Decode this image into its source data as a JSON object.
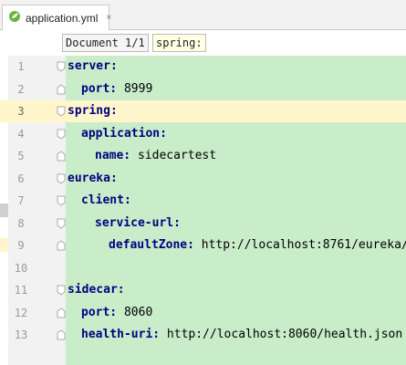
{
  "tab": {
    "file_name": "application.yml",
    "close_glyph": "×",
    "icon": "yaml-file-icon"
  },
  "breadcrumb": {
    "document": "Document 1/1",
    "path": "spring:"
  },
  "editor": {
    "caret_line": 3,
    "lines": [
      {
        "num": "1",
        "indent": 0,
        "key": "server:",
        "value": ""
      },
      {
        "num": "2",
        "indent": 1,
        "key": "port:",
        "value": "8999"
      },
      {
        "num": "3",
        "indent": 0,
        "key": "spring:",
        "value": ""
      },
      {
        "num": "4",
        "indent": 1,
        "key": "application:",
        "value": ""
      },
      {
        "num": "5",
        "indent": 2,
        "key": "name:",
        "value": "sidecartest"
      },
      {
        "num": "6",
        "indent": 0,
        "key": "eureka:",
        "value": ""
      },
      {
        "num": "7",
        "indent": 1,
        "key": "client:",
        "value": ""
      },
      {
        "num": "8",
        "indent": 2,
        "key": "service-url:",
        "value": ""
      },
      {
        "num": "9",
        "indent": 3,
        "key": "defaultZone:",
        "value": "http://localhost:8761/eureka/"
      },
      {
        "num": "10",
        "indent": 0,
        "key": "",
        "value": ""
      },
      {
        "num": "11",
        "indent": 0,
        "key": "sidecar:",
        "value": ""
      },
      {
        "num": "12",
        "indent": 1,
        "key": "port:",
        "value": "8060"
      },
      {
        "num": "13",
        "indent": 1,
        "key": "health-uri:",
        "value": "http://localhost:8060/health.json"
      }
    ]
  },
  "colors": {
    "key": "#000080",
    "editor_background": "#c9ecc9",
    "caret_row": "#fff6cc"
  }
}
